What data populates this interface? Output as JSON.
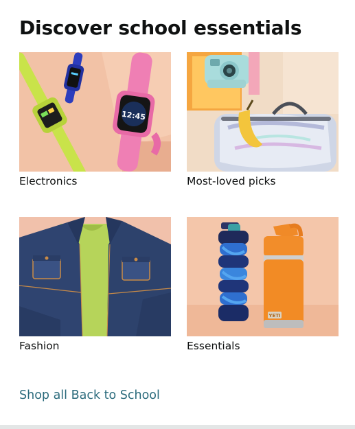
{
  "card": {
    "title": "Discover school essentials",
    "tiles": [
      {
        "label": "Electronics",
        "image_subject": "kids smartwatches on peach background"
      },
      {
        "label": "Most-loved picks",
        "image_subject": "instant camera, banana and holographic lunch bag"
      },
      {
        "label": "Fashion",
        "image_subject": "denim jacket over green t-shirt"
      },
      {
        "label": "Essentials",
        "image_subject": "collapsible blue water bottle and orange tumbler"
      }
    ],
    "link_text": "Shop all Back to School"
  },
  "colors": {
    "title": "#0f1111",
    "link": "#2b6b7c",
    "bottom_band": "#e3e6e6"
  }
}
